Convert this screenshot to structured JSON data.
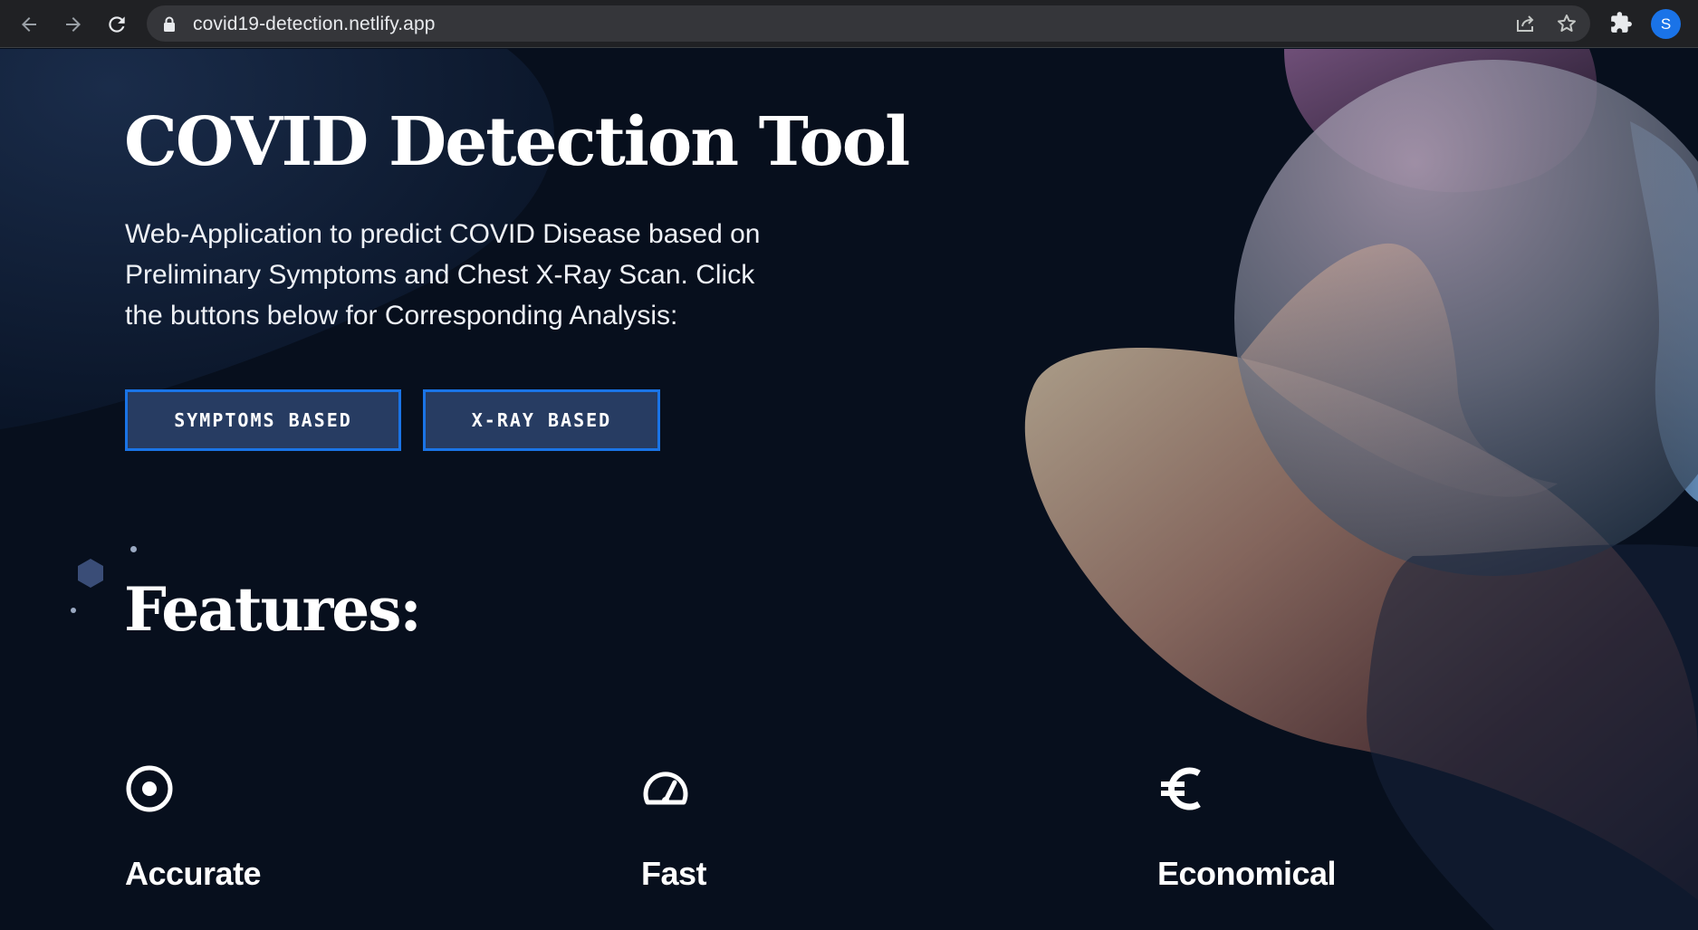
{
  "browser": {
    "url": "covid19-detection.netlify.app",
    "profile_initial": "S",
    "icons": [
      "back-arrow-icon",
      "forward-arrow-icon",
      "reload-icon",
      "lock-icon",
      "share-icon",
      "star-icon",
      "extensions-puzzle-icon"
    ]
  },
  "hero": {
    "title": "COVID Detection Tool",
    "description": "Web-Application to predict COVID Disease based on Preliminary Symptoms and Chest X-Ray Scan. Click the buttons below for Corresponding Analysis:",
    "buttons": {
      "symptoms": "SYMPTOMS BASED",
      "xray": "X-RAY BASED"
    }
  },
  "features": {
    "title": "Features:",
    "items": [
      {
        "name": "Accurate",
        "icon": "target-icon"
      },
      {
        "name": "Fast",
        "icon": "speedometer-icon"
      },
      {
        "name": "Economical",
        "icon": "euro-icon"
      }
    ]
  },
  "colors": {
    "page_background": "#070f1d",
    "button_fill": "#273c62",
    "button_border": "#1a74e6",
    "chrome_background": "#202124",
    "avatar": "#1a73e8"
  }
}
